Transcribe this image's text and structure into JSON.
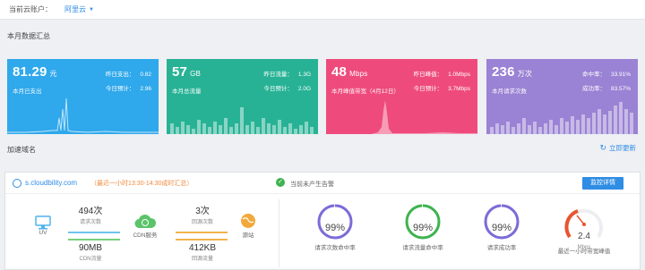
{
  "account": {
    "label": "当前云账户：",
    "name": "阿里云"
  },
  "summary": {
    "title": "本月数据汇总"
  },
  "cards": [
    {
      "value": "81.29",
      "unit": "元",
      "caption": "本月已支出",
      "r1_label": "昨日支出：",
      "r1_value": "0.82",
      "r2_label": "今日预计：",
      "r2_value": "2.96",
      "color": "#2fa8ec"
    },
    {
      "value": "57",
      "unit": "GB",
      "caption": "本月总流量",
      "r1_label": "昨日流量：",
      "r1_value": "1.3G",
      "r2_label": "今日预计：",
      "r2_value": "2.0G",
      "color": "#28b295"
    },
    {
      "value": "48",
      "unit": "Mbps",
      "caption": "本月峰值带宽（4月12日）",
      "r1_label": "昨日峰值：",
      "r1_value": "1.0Mbps",
      "r2_label": "今日预计：",
      "r2_value": "3.7Mbps",
      "color": "#ee4b7c"
    },
    {
      "value": "236",
      "unit": "万次",
      "caption": "本月请求次数",
      "r1_label": "命中率：",
      "r1_value": "33.91%",
      "r2_label": "成功率：",
      "r2_value": "83.57%",
      "color": "#9a82d4"
    }
  ],
  "domains": {
    "title": "加速域名",
    "refresh_label": "立即更新"
  },
  "domain_row": {
    "domain": "s.cloudbility.com",
    "hint": "（最近一小时13:30-14:30成时汇总）",
    "status": "当前未产生告警",
    "detail_button": "监控详情",
    "uv_label": "UV",
    "cdn_label": "CDN服务",
    "origin_label": "源站",
    "requests_value": "494次",
    "requests_label": "请求次数",
    "cdn_traffic_value": "90MB",
    "cdn_traffic_label": "CDN流量",
    "origin_requests_value": "3次",
    "origin_requests_label": "回源次数",
    "origin_traffic_value": "412KB",
    "origin_traffic_label": "回源流量"
  },
  "gauges": [
    {
      "value": "99%",
      "label": "请求次数命中率",
      "percent": 99,
      "color": "#7b6cd8"
    },
    {
      "value": "99%",
      "label": "请求流量命中率",
      "percent": 99,
      "color": "#3fb34f"
    },
    {
      "value": "99%",
      "label": "请求成功率",
      "percent": 99,
      "color": "#7b6cd8"
    },
    {
      "value": "2.4",
      "unit": "Mbps",
      "label": "最近一小时带宽峰值",
      "color": "#e8542e"
    }
  ]
}
